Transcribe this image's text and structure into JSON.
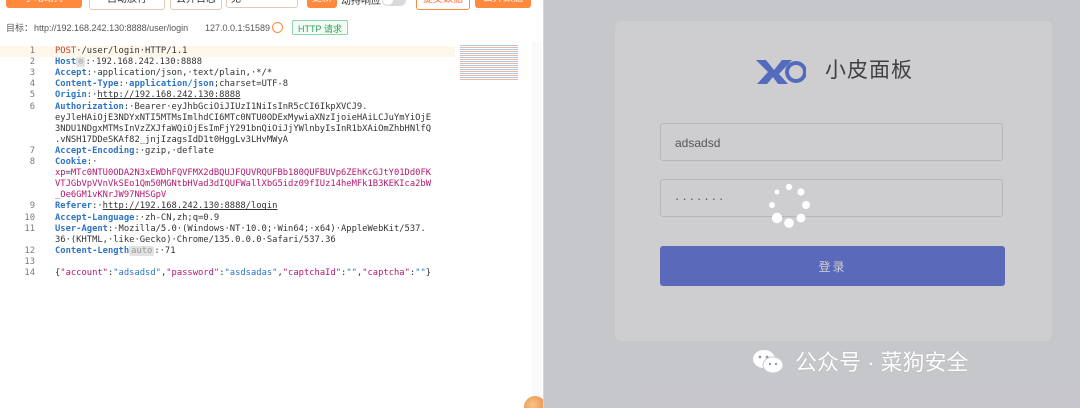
{
  "toolbar": {
    "btn_manual": "手动劫持",
    "btn_auto": "自动放行",
    "btn_drop": "丢弃日志",
    "select_value": "无",
    "btn_modify": "更新",
    "hijack_response_label": "劫持响应",
    "btn_submit": "提交数据",
    "btn_drop_packet": "丢弃数据"
  },
  "target": {
    "label": "目标：",
    "url": "http://192.168.242.130:8888/user/login",
    "ip": "127.0.0.1:51589",
    "protocol_badge": "HTTP 请求"
  },
  "request": {
    "lines": [
      {
        "n": "1",
        "parts": [
          [
            "method",
            "POST"
          ],
          [
            "plain",
            "·/user/login·HTTP/1.1"
          ]
        ]
      },
      {
        "n": "2",
        "parts": [
          [
            "k",
            "Host"
          ],
          [
            "badge",
            "⊙"
          ],
          [
            "plain",
            ":·192.168.242.130:8888"
          ]
        ]
      },
      {
        "n": "3",
        "parts": [
          [
            "k",
            "Accept"
          ],
          [
            "plain",
            ":·application/json,·text/plain,·*/*"
          ]
        ]
      },
      {
        "n": "4",
        "parts": [
          [
            "k",
            "Content-Type"
          ],
          [
            "plain",
            ":·"
          ],
          [
            "k",
            "application/json"
          ],
          [
            "plain",
            ";charset=UTF-8"
          ]
        ]
      },
      {
        "n": "5",
        "parts": [
          [
            "k",
            "Origin"
          ],
          [
            "plain",
            ":·"
          ],
          [
            "u",
            "http://192.168.242.130:8888"
          ]
        ]
      },
      {
        "n": "6",
        "parts": [
          [
            "k",
            "Authorization"
          ],
          [
            "plain",
            ":·Bearer·eyJhbGciOiJIUzI1NiIsInR5cCI6IkpXVCJ9."
          ]
        ]
      },
      {
        "n": "",
        "parts": [
          [
            "plain",
            "eyJleHAiOjE3NDYxNTI5MTMsImlhdCI6MTc0NTU0ODExMywiaXNzIjoieHAiLCJuYmYiOjE"
          ]
        ]
      },
      {
        "n": "",
        "parts": [
          [
            "plain",
            "3NDU1NDgxMTMsInVzZXJfaWQiOjEsImFjY291bnQiOiJjYWlnbyIsInR1bXAiOmZhbHNlfQ"
          ]
        ]
      },
      {
        "n": "",
        "parts": [
          [
            "plain",
            ".vNSH17DDeSKAf82_jnjIzagsIdD1t0HggLv3LHvMWyA"
          ]
        ]
      },
      {
        "n": "7",
        "parts": [
          [
            "k",
            "Accept-Encoding"
          ],
          [
            "plain",
            ":·gzip,·deflate"
          ]
        ]
      },
      {
        "n": "8",
        "parts": [
          [
            "k",
            "Cookie"
          ],
          [
            "plain",
            ":·"
          ]
        ]
      },
      {
        "n": "",
        "parts": [
          [
            "cookie",
            "xp"
          ],
          [
            "plain",
            "="
          ],
          [
            "cookie",
            "MTc0NTU0ODA2N3xEWDhFQVFMX2dBQUJFQUVRQUFBb180QUFBUVp6ZEhKcGJtY01Dd0FK"
          ]
        ]
      },
      {
        "n": "",
        "parts": [
          [
            "cookie",
            "VTJGbVpVVnVkSEo1Qm50MGNtbHVad3dIQUFWallXbG5idz09fIUz14heMFk1B3KEKIca2bW"
          ]
        ]
      },
      {
        "n": "",
        "parts": [
          [
            "cookie",
            "_Oe6GM1vKNrJW97NHSGpV"
          ]
        ]
      },
      {
        "n": "9",
        "parts": [
          [
            "k",
            "Referer"
          ],
          [
            "plain",
            ":·"
          ],
          [
            "u",
            "http://192.168.242.130:8888/login"
          ]
        ]
      },
      {
        "n": "10",
        "parts": [
          [
            "k",
            "Accept-Language"
          ],
          [
            "plain",
            ":·zh-CN,zh;q=0.9"
          ]
        ]
      },
      {
        "n": "11",
        "parts": [
          [
            "k",
            "User-Agent"
          ],
          [
            "plain",
            ":·Mozilla/5.0·(Windows·NT·10.0;·Win64;·x64)·AppleWebKit/537."
          ]
        ]
      },
      {
        "n": "",
        "parts": [
          [
            "plain",
            "36·(KHTML,·like·Gecko)·Chrome/135.0.0.0·Safari/537.36"
          ]
        ]
      },
      {
        "n": "12",
        "parts": [
          [
            "k",
            "Content-Length"
          ],
          [
            "badge",
            "auto"
          ],
          [
            "plain",
            ":·71"
          ]
        ]
      },
      {
        "n": "13",
        "parts": [
          [
            "plain",
            ""
          ]
        ]
      },
      {
        "n": "14",
        "parts": [
          [
            "plain",
            "{"
          ],
          [
            "jk",
            "\"account\""
          ],
          [
            "plain",
            ":"
          ],
          [
            "jv",
            "\"adsadsd\""
          ],
          [
            "plain",
            ","
          ],
          [
            "jk",
            "\"password\""
          ],
          [
            "plain",
            ":"
          ],
          [
            "jv",
            "\"asdsadas\""
          ],
          [
            "plain",
            ","
          ],
          [
            "jk",
            "\"captchaId\""
          ],
          [
            "plain",
            ":"
          ],
          [
            "jv",
            "\"\""
          ],
          [
            "plain",
            ","
          ],
          [
            "jk",
            "\"captcha\""
          ],
          [
            "plain",
            ":"
          ],
          [
            "jv",
            "\"\""
          ],
          [
            "plain",
            "}"
          ]
        ]
      }
    ]
  },
  "login": {
    "brand": "小皮面板",
    "account_value": "adsadsd",
    "password_mask": "·······",
    "login_button": "登录"
  },
  "watermark": {
    "text": "公众号 · 菜狗安全"
  },
  "colors": {
    "accent_orange": "#ff8a3d",
    "header_key_blue": "#2d74c4",
    "cookie_magenta": "#b5176f",
    "login_button": "#4a62d9"
  }
}
